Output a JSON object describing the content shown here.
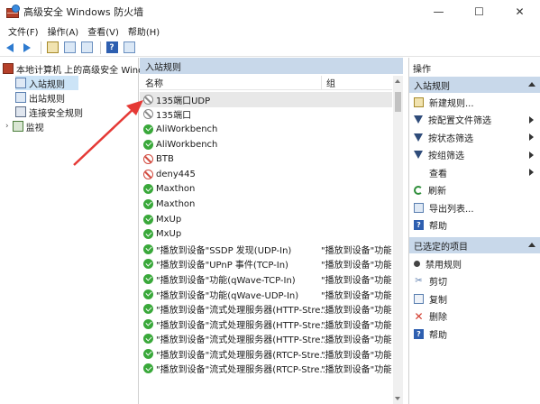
{
  "window": {
    "title": "高级安全 Windows 防火墙",
    "min": "—",
    "max": "☐",
    "close": "✕"
  },
  "menu": [
    "文件(F)",
    "操作(A)",
    "查看(V)",
    "帮助(H)"
  ],
  "tree": {
    "root": "本地计算机 上的高级安全 Windows",
    "items": [
      "入站规则",
      "出站规则",
      "连接安全规则",
      "监视"
    ],
    "selected": "入站规则"
  },
  "center": {
    "header": "入站规则",
    "columns": {
      "name": "名称",
      "group": "组"
    },
    "rows": [
      {
        "name": "135端口UDP",
        "group": "",
        "status": "none",
        "highlight": true
      },
      {
        "name": "135端口",
        "group": "",
        "status": "none"
      },
      {
        "name": "AliWorkbench",
        "group": "",
        "status": "green"
      },
      {
        "name": "AliWorkbench",
        "group": "",
        "status": "green"
      },
      {
        "name": "BTB",
        "group": "",
        "status": "block"
      },
      {
        "name": "deny445",
        "group": "",
        "status": "block"
      },
      {
        "name": "Maxthon",
        "group": "",
        "status": "green"
      },
      {
        "name": "Maxthon",
        "group": "",
        "status": "green"
      },
      {
        "name": "MxUp",
        "group": "",
        "status": "green"
      },
      {
        "name": "MxUp",
        "group": "",
        "status": "green"
      },
      {
        "name": "\"播放到设备\"SSDP 发现(UDP-In)",
        "group": "\"播放到设备\"功能",
        "status": "green"
      },
      {
        "name": "\"播放到设备\"UPnP 事件(TCP-In)",
        "group": "\"播放到设备\"功能",
        "status": "green"
      },
      {
        "name": "\"播放到设备\"功能(qWave-TCP-In)",
        "group": "\"播放到设备\"功能",
        "status": "green"
      },
      {
        "name": "\"播放到设备\"功能(qWave-UDP-In)",
        "group": "\"播放到设备\"功能",
        "status": "green"
      },
      {
        "name": "\"播放到设备\"流式处理服务器(HTTP-Stre...",
        "group": "\"播放到设备\"功能",
        "status": "green"
      },
      {
        "name": "\"播放到设备\"流式处理服务器(HTTP-Stre...",
        "group": "\"播放到设备\"功能",
        "status": "green"
      },
      {
        "name": "\"播放到设备\"流式处理服务器(HTTP-Stre...",
        "group": "\"播放到设备\"功能",
        "status": "green"
      },
      {
        "name": "\"播放到设备\"流式处理服务器(RTCP-Stre...",
        "group": "\"播放到设备\"功能",
        "status": "green"
      },
      {
        "name": "\"播放到设备\"流式处理服务器(RTCP-Stre...",
        "group": "\"播放到设备\"功能",
        "status": "green"
      }
    ]
  },
  "actions": {
    "title": "操作",
    "section1": "入站规则",
    "items1": [
      {
        "label": "新建规则...",
        "icon": "new-rule-icon",
        "sub": false
      },
      {
        "label": "按配置文件筛选",
        "icon": "filter-icon",
        "sub": true
      },
      {
        "label": "按状态筛选",
        "icon": "filter-icon",
        "sub": true
      },
      {
        "label": "按组筛选",
        "icon": "filter-icon",
        "sub": true
      },
      {
        "label": "查看",
        "icon": "",
        "sub": true
      },
      {
        "label": "刷新",
        "icon": "refresh-icon",
        "sub": false
      },
      {
        "label": "导出列表...",
        "icon": "export-icon",
        "sub": false
      },
      {
        "label": "帮助",
        "icon": "help-icon",
        "sub": false
      }
    ],
    "section2": "已选定的项目",
    "items2": [
      {
        "label": "禁用规则",
        "icon": "disable-icon"
      },
      {
        "label": "剪切",
        "icon": "cut-icon"
      },
      {
        "label": "复制",
        "icon": "copy-icon"
      },
      {
        "label": "删除",
        "icon": "delete-icon"
      },
      {
        "label": "帮助",
        "icon": "help-icon"
      }
    ]
  },
  "colors": {
    "accent": "#2e7bd0",
    "header_bg": "#c8d8ea",
    "annotation_arrow": "#e53935"
  }
}
